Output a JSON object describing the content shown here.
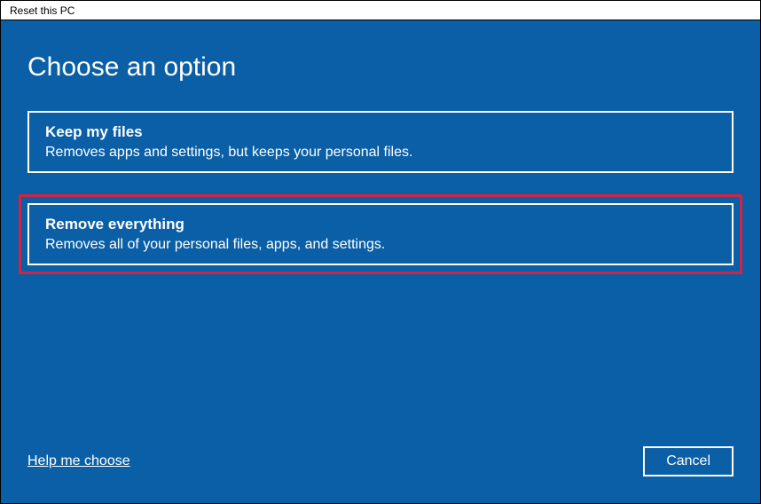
{
  "window": {
    "title": "Reset this PC"
  },
  "heading": "Choose an option",
  "options": [
    {
      "title": "Keep my files",
      "description": "Removes apps and settings, but keeps your personal files."
    },
    {
      "title": "Remove everything",
      "description": "Removes all of your personal files, apps, and settings."
    }
  ],
  "footer": {
    "help_link": "Help me choose",
    "cancel_label": "Cancel"
  }
}
